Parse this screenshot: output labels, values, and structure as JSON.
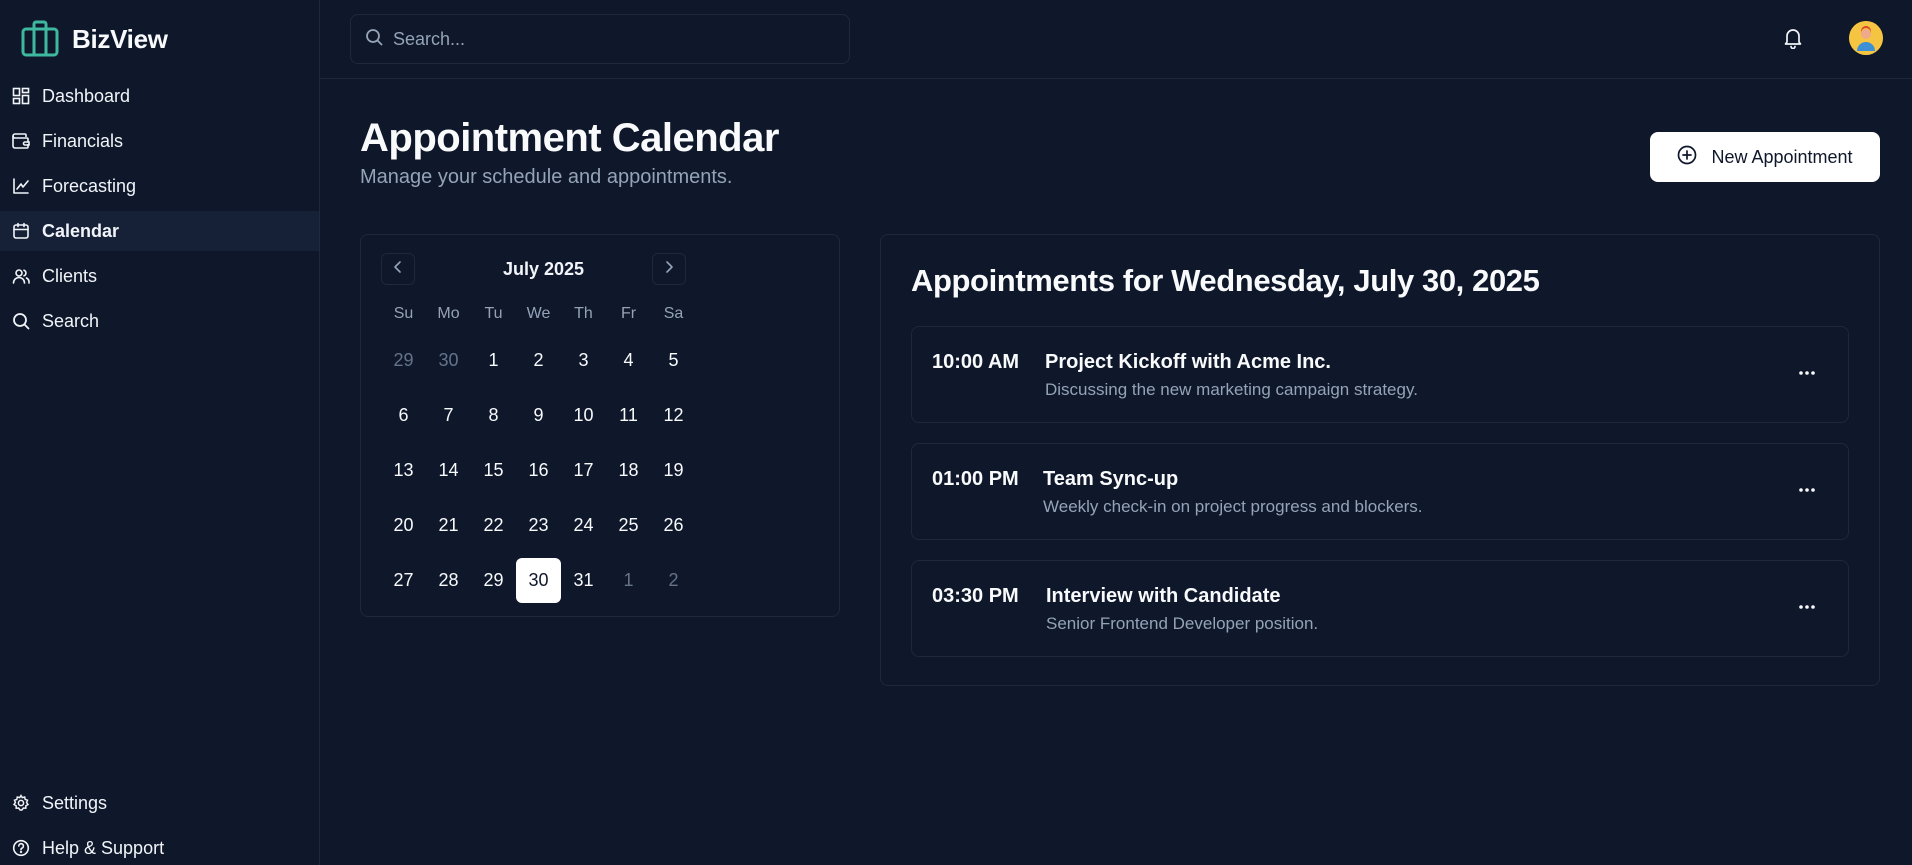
{
  "app": {
    "name": "BizView"
  },
  "sidebar": {
    "items": [
      {
        "label": "Dashboard",
        "icon": "dashboard-icon"
      },
      {
        "label": "Financials",
        "icon": "wallet-icon"
      },
      {
        "label": "Forecasting",
        "icon": "line-chart-icon"
      },
      {
        "label": "Calendar",
        "icon": "calendar-icon",
        "active": true
      },
      {
        "label": "Clients",
        "icon": "users-icon"
      },
      {
        "label": "Search",
        "icon": "search-icon"
      }
    ],
    "bottom": [
      {
        "label": "Settings",
        "icon": "gear-icon"
      },
      {
        "label": "Help & Support",
        "icon": "help-icon"
      }
    ]
  },
  "topbar": {
    "search_placeholder": "Search..."
  },
  "page": {
    "title": "Appointment Calendar",
    "subtitle": "Manage your schedule and appointments.",
    "new_button_label": "New Appointment"
  },
  "calendar": {
    "month_label": "July 2025",
    "weekdays": [
      "Su",
      "Mo",
      "Tu",
      "We",
      "Th",
      "Fr",
      "Sa"
    ],
    "days": [
      {
        "d": "29",
        "muted": true
      },
      {
        "d": "30",
        "muted": true
      },
      {
        "d": "1"
      },
      {
        "d": "2"
      },
      {
        "d": "3"
      },
      {
        "d": "4"
      },
      {
        "d": "5"
      },
      {
        "d": "6"
      },
      {
        "d": "7"
      },
      {
        "d": "8"
      },
      {
        "d": "9"
      },
      {
        "d": "10"
      },
      {
        "d": "11"
      },
      {
        "d": "12"
      },
      {
        "d": "13"
      },
      {
        "d": "14"
      },
      {
        "d": "15"
      },
      {
        "d": "16"
      },
      {
        "d": "17"
      },
      {
        "d": "18"
      },
      {
        "d": "19"
      },
      {
        "d": "20"
      },
      {
        "d": "21"
      },
      {
        "d": "22"
      },
      {
        "d": "23"
      },
      {
        "d": "24"
      },
      {
        "d": "25"
      },
      {
        "d": "26"
      },
      {
        "d": "27"
      },
      {
        "d": "28"
      },
      {
        "d": "29"
      },
      {
        "d": "30",
        "selected": true
      },
      {
        "d": "31"
      },
      {
        "d": "1",
        "muted": true
      },
      {
        "d": "2",
        "muted": true
      }
    ]
  },
  "appointments": {
    "heading": "Appointments for Wednesday, July 30, 2025",
    "items": [
      {
        "time": "10:00 AM",
        "title": "Project Kickoff with Acme Inc.",
        "description": "Discussing the new marketing campaign strategy."
      },
      {
        "time": "01:00 PM",
        "title": "Team Sync-up",
        "description": "Weekly check-in on project progress and blockers."
      },
      {
        "time": "03:30 PM",
        "title": "Interview with Candidate",
        "description": "Senior Frontend Developer position."
      }
    ]
  },
  "colors": {
    "background": "#0f172a",
    "border": "#1e293b",
    "muted_text": "#94a3b8",
    "brand_accent": "#3fb8a0"
  }
}
